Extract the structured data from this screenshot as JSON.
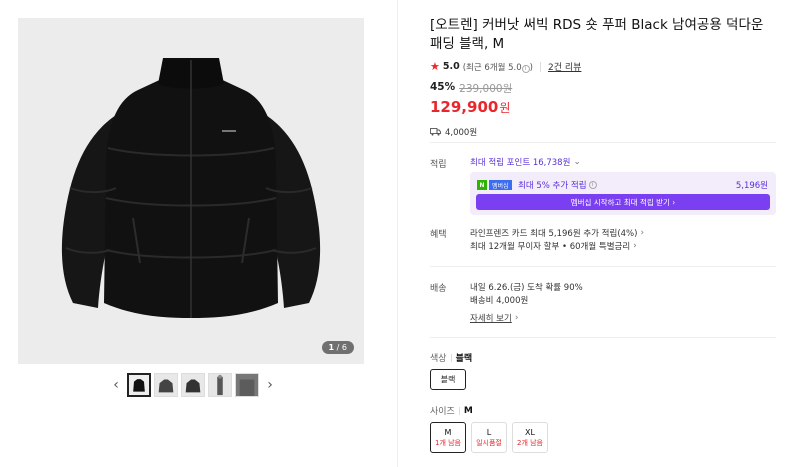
{
  "gallery": {
    "counter_current": "1",
    "counter_total": "/ 6",
    "prev_icon": "‹",
    "next_icon": "›"
  },
  "product": {
    "title": "[오트렌] 커버낫 써빅 RDS 숏 푸퍼 Black 남여공용 덕다운 패딩 블랙, M",
    "rating_score": "5.0",
    "rating_recent": "(최근 6개월 5.0",
    "rating_recent_close": ")",
    "review_count": "2건 리뷰",
    "discount": "45%",
    "original_price": "239,000원",
    "sale_price": "129,900",
    "currency": "원",
    "shipping_fee": "4,000원"
  },
  "points": {
    "label": "적립",
    "max_points": "최대 적립 포인트 16,738원",
    "npay_n": "N",
    "npay_plus": "멤버십",
    "extra_text": "최대 5% 추가 적립",
    "extra_amount": "5,196원",
    "cta": "멤버십 시작하고 최대 적립 받기 ›"
  },
  "benefits": {
    "label": "혜택",
    "line1": "라인프렌즈 카드 최대 5,196원 추가 적립(4%)",
    "line2": "최대 12개월 무이자 할부 • 60개월 특별금리"
  },
  "delivery": {
    "label": "배송",
    "line1": "내일 6.26.(금) 도착 확률 90%",
    "line2": "배송비 4,000원",
    "details_link": "자세히 보기"
  },
  "options": {
    "color_label": "색상",
    "color_value": "블랙",
    "color_button": "블랙",
    "size_label": "사이즈",
    "size_value": "M",
    "sizes": [
      {
        "size": "M",
        "stock": "1개 남음"
      },
      {
        "size": "L",
        "stock": "일시품절"
      },
      {
        "size": "XL",
        "stock": "2개 남음"
      }
    ]
  },
  "colors": {
    "accent_red": "#e9262b",
    "accent_purple": "#7b3ff2"
  }
}
